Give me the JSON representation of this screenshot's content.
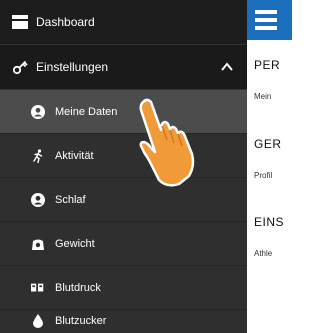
{
  "sidebar": {
    "dashboard_label": "Dashboard",
    "settings_label": "Einstellungen",
    "items": [
      {
        "label": "Meine Daten",
        "icon": "user-circle-icon"
      },
      {
        "label": "Aktivität",
        "icon": "running-person-icon"
      },
      {
        "label": "Schlaf",
        "icon": "user-circle-icon"
      },
      {
        "label": "Gewicht",
        "icon": "scale-icon"
      },
      {
        "label": "Blutdruck",
        "icon": "blood-pressure-icon"
      },
      {
        "label": "Blutzucker",
        "icon": "drop-icon"
      }
    ]
  },
  "main": {
    "sections": [
      {
        "title": "PER",
        "subtitle": "Mein"
      },
      {
        "title": "GER",
        "subtitle": "Profil"
      },
      {
        "title": "EINS",
        "subtitle": "Athle"
      }
    ]
  },
  "colors": {
    "accent": "#1c6fbd",
    "pointer_hand": "#f09a3a"
  }
}
